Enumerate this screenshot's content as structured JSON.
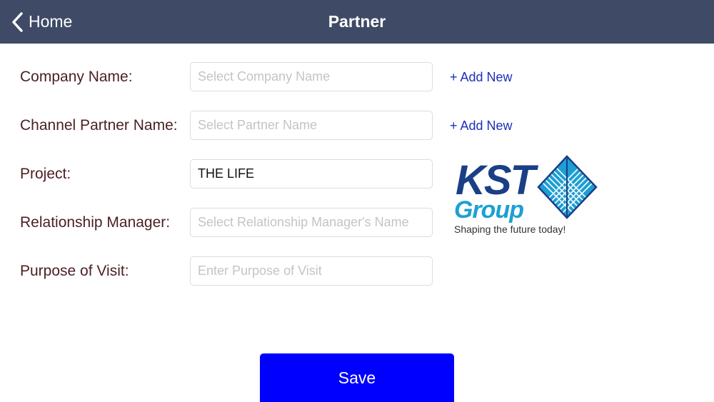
{
  "nav": {
    "back_label": "Home",
    "title": "Partner",
    "back_icon": "chevron-left-icon",
    "bar_color": "#3f4b66"
  },
  "form": {
    "company": {
      "label": "Company Name:",
      "placeholder": "Select Company Name",
      "value": "",
      "add_label": "+ Add New"
    },
    "partner": {
      "label": "Channel Partner Name:",
      "placeholder": "Select Partner Name",
      "value": "",
      "add_label": "+ Add New"
    },
    "project": {
      "label": "Project:",
      "placeholder": "",
      "value": "THE LIFE"
    },
    "manager": {
      "label": "Relationship Manager:",
      "placeholder": "Select Relationship Manager's Name",
      "value": ""
    },
    "purpose": {
      "label": "Purpose of Visit:",
      "placeholder": "Enter Purpose of Visit",
      "value": ""
    }
  },
  "logo": {
    "line1": "KST",
    "line2": "Group",
    "tagline": "Shaping the future today!"
  },
  "save": {
    "label": "Save",
    "color": "#0000ff"
  }
}
